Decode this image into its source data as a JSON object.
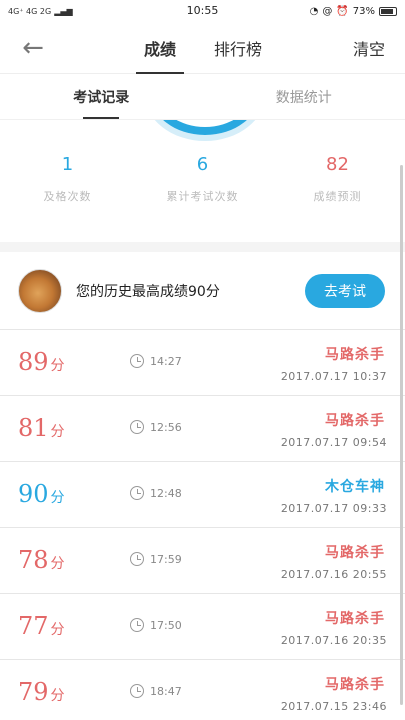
{
  "status_bar": {
    "network": "4G⁺ 4G 2G",
    "time": "10:55",
    "battery_percent": "73%"
  },
  "header": {
    "back_icon": "arrow-left-icon",
    "tabs": [
      {
        "label": "成绩",
        "active": true
      },
      {
        "label": "排行榜",
        "active": false
      }
    ],
    "clear_label": "清空"
  },
  "sub_tabs": [
    {
      "label": "考试记录",
      "active": true
    },
    {
      "label": "数据统计",
      "active": false
    }
  ],
  "stats": [
    {
      "value": "1",
      "label": "及格次数",
      "color": "#29a8e0"
    },
    {
      "value": "6",
      "label": "累计考试次数",
      "color": "#29a8e0"
    },
    {
      "value": "82",
      "label": "成绩预测",
      "color": "#e36868"
    }
  ],
  "best": {
    "text": "您的历史最高成绩90分",
    "button_label": "去考试"
  },
  "records": [
    {
      "score": "89",
      "unit": "分",
      "duration": "14:27",
      "title": "马路杀手",
      "date": "2017.07.17  10:37",
      "color": "#e36868"
    },
    {
      "score": "81",
      "unit": "分",
      "duration": "12:56",
      "title": "马路杀手",
      "date": "2017.07.17  09:54",
      "color": "#e36868"
    },
    {
      "score": "90",
      "unit": "分",
      "duration": "12:48",
      "title": "木仓车神",
      "date": "2017.07.17  09:33",
      "color": "#29a8e0"
    },
    {
      "score": "78",
      "unit": "分",
      "duration": "17:59",
      "title": "马路杀手",
      "date": "2017.07.16  20:55",
      "color": "#e36868"
    },
    {
      "score": "77",
      "unit": "分",
      "duration": "17:50",
      "title": "马路杀手",
      "date": "2017.07.16  20:35",
      "color": "#e36868"
    },
    {
      "score": "79",
      "unit": "分",
      "duration": "18:47",
      "title": "马路杀手",
      "date": "2017.07.15  23:46",
      "color": "#e36868"
    }
  ],
  "colors": {
    "accent": "#29a8e0",
    "fail": "#e36868"
  }
}
